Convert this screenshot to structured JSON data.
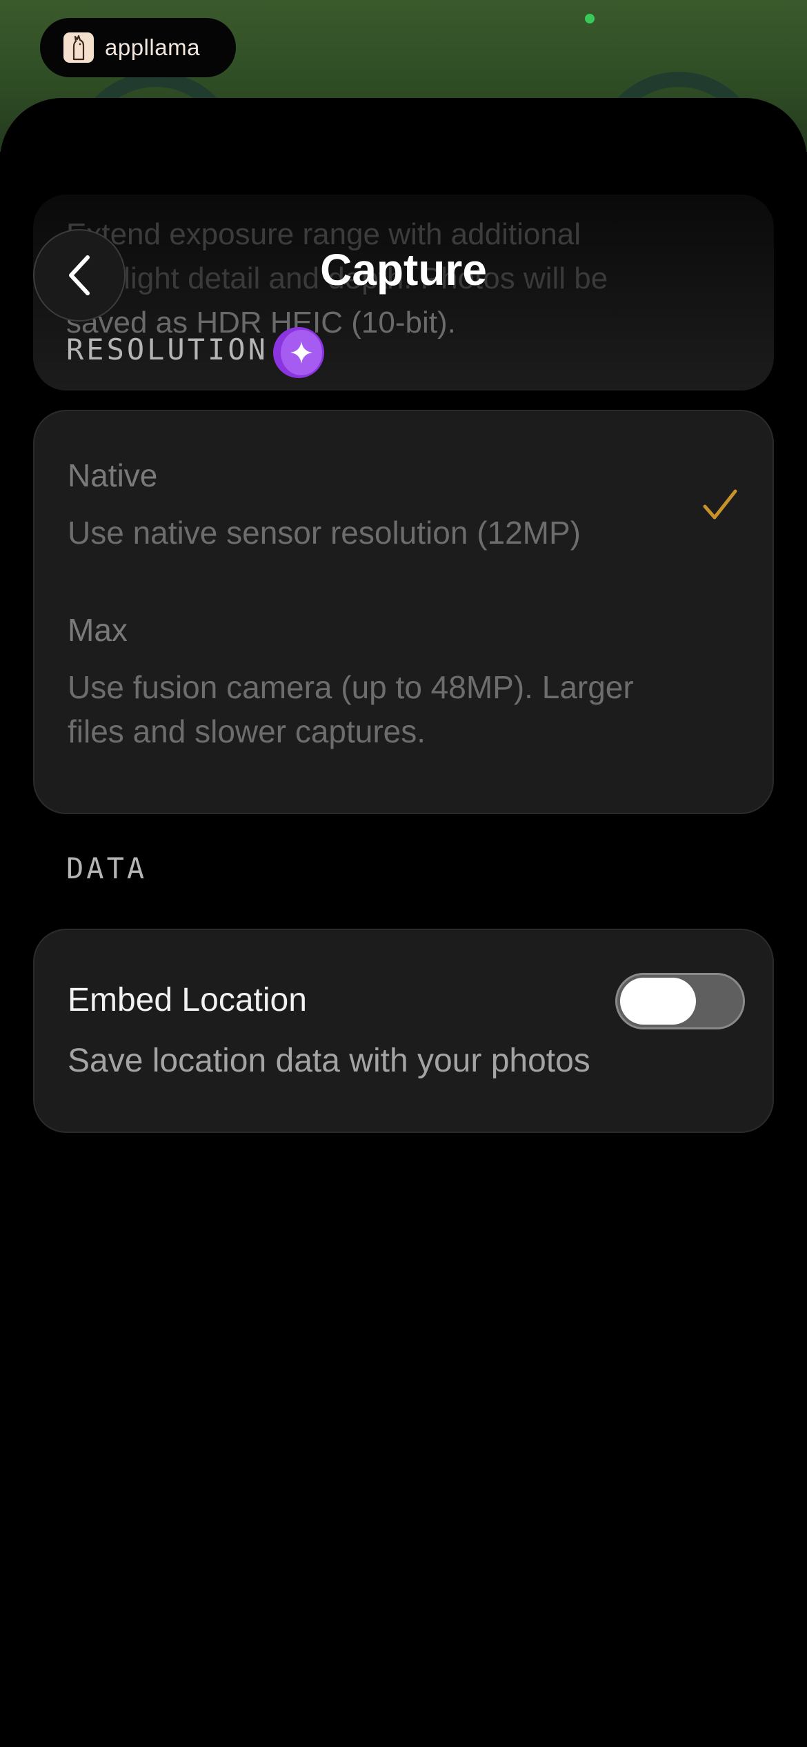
{
  "brand": {
    "name": "appllama",
    "logo_icon": "llama-icon"
  },
  "header": {
    "title": "Capture",
    "back_icon": "chevron-left-icon"
  },
  "info_card": {
    "line1": "Extend exposure range with additional",
    "line2_visible": "highlight detail and ",
    "line2_faded": "depth. Photos will be",
    "line3": "saved as HDR HEIC (10-bit)."
  },
  "resolution": {
    "section_label": "RESOLUTION",
    "badge_icon": "sparkle-icon",
    "options": [
      {
        "title": "Native",
        "desc": "Use native sensor resolution (12MP)",
        "selected": true
      },
      {
        "title": "Max",
        "desc_line1": "Use fusion camera (up to 48MP). Larger",
        "desc_line2": "files and slower captures.",
        "selected": false
      }
    ],
    "check_color": "#c8922a"
  },
  "data_section": {
    "section_label": "DATA",
    "embed_location": {
      "title": "Embed Location",
      "desc": "Save location data with your photos",
      "enabled": false
    }
  },
  "colors": {
    "accent_purple": "#8b35e0",
    "check": "#c8922a",
    "status_dot": "#39c85a"
  }
}
